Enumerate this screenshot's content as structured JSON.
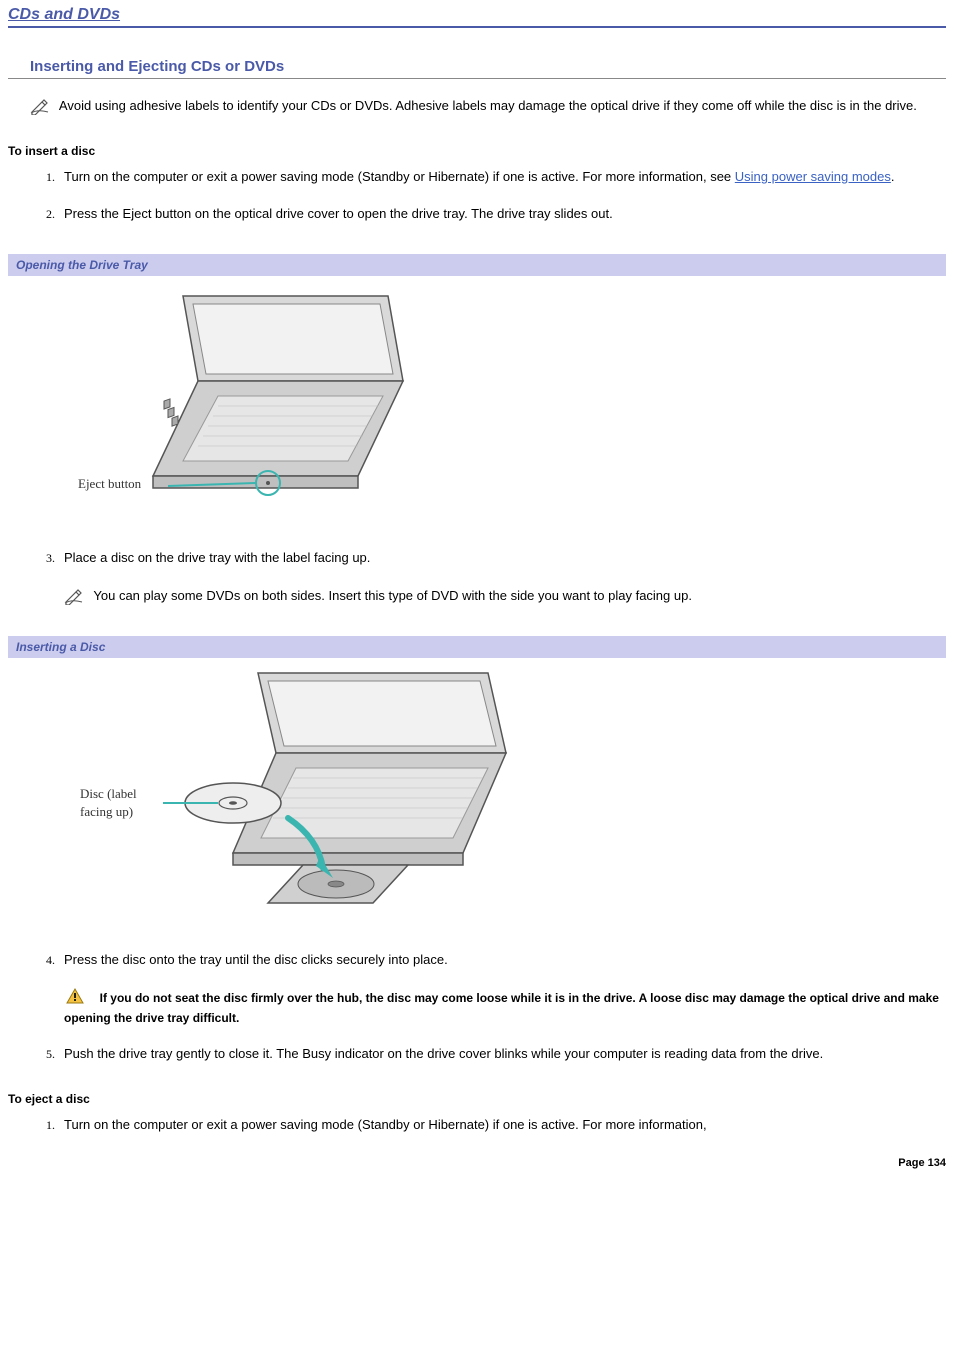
{
  "page": {
    "top_title": "CDs and DVDs",
    "section_title": "Inserting and Ejecting CDs or DVDs",
    "note1": "Avoid using adhesive labels to identify your CDs or DVDs. Adhesive labels may damage the optical drive if they come off while the disc is in the drive.",
    "sub_insert": "To insert a disc",
    "insert_steps": {
      "s1_a": "Turn on the computer or exit a power saving mode (Standby or Hibernate) if one is active. For more information, see ",
      "s1_link": "Using power saving modes",
      "s1_b": ".",
      "s2": "Press the Eject button on the optical drive cover to open the drive tray. The drive tray slides out.",
      "s3": "Place a disc on the drive tray with the label facing up.",
      "s3_note": "You can play some DVDs on both sides. Insert this type of DVD with the side you want to play facing up.",
      "s4": "Press the disc onto the tray until the disc clicks securely into place.",
      "s4_warn": "If you do not seat the disc firmly over the hub, the disc may come loose while it is in the drive. A loose disc may damage the optical drive and make opening the drive tray difficult.",
      "s5": "Push the drive tray gently to close it. The Busy indicator on the drive cover blinks while your computer is reading data from the drive."
    },
    "fig1_caption": "Opening the Drive Tray",
    "fig1_label": "Eject button",
    "fig2_caption": "Inserting a Disc",
    "fig2_label1": "Disc (label",
    "fig2_label2": "facing up)",
    "sub_eject": "To eject a disc",
    "eject_steps": {
      "s1": "Turn on the computer or exit a power saving mode (Standby or Hibernate) if one is active. For more information,"
    },
    "footer": "Page 134"
  }
}
